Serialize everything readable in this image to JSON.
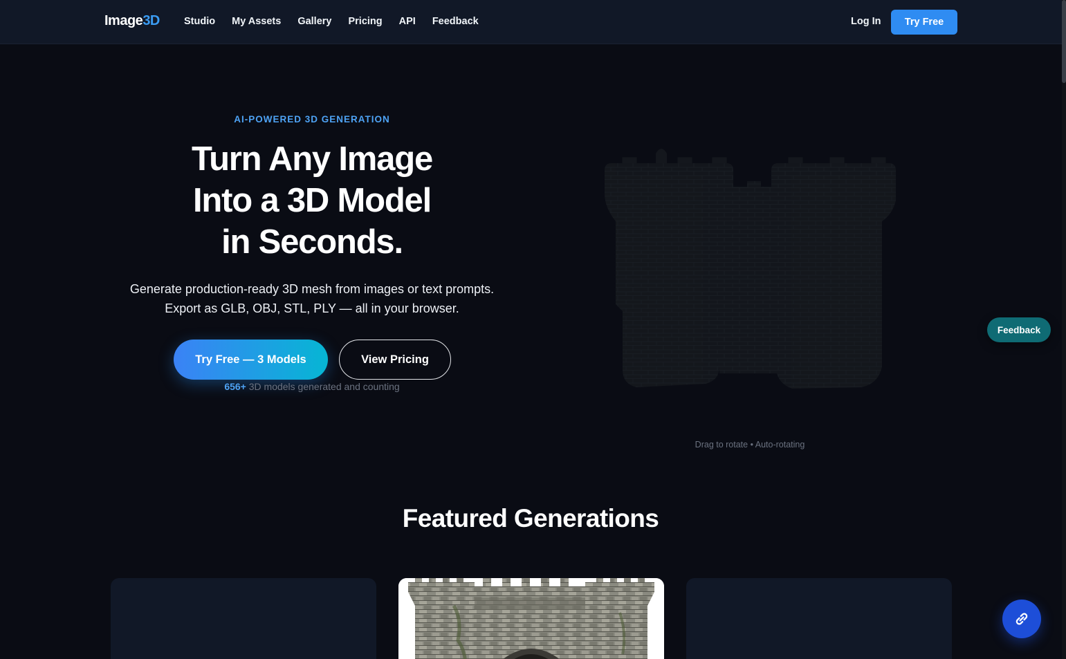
{
  "brand": {
    "name_main": "Image",
    "name_accent": "3D"
  },
  "nav": {
    "links": [
      "Studio",
      "My Assets",
      "Gallery",
      "Pricing",
      "API",
      "Feedback"
    ],
    "login": "Log In",
    "try_free": "Try Free"
  },
  "hero": {
    "eyebrow": "AI-POWERED 3D GENERATION",
    "title_line1": "Turn Any Image",
    "title_line2": "Into a 3D Model",
    "title_line3": "in Seconds.",
    "sub_line1": "Generate production-ready 3D mesh from images or text prompts.",
    "sub_line2": "Export as GLB, OBJ, STL, PLY — all in your browser.",
    "cta_primary": "Try Free — 3 Models",
    "cta_secondary": "View Pricing",
    "stat_number": "656+",
    "stat_text": " 3D models generated and counting",
    "viewer_hint": "Drag to rotate • Auto-rotating"
  },
  "floating": {
    "feedback": "Feedback"
  },
  "featured": {
    "title": "Featured Generations"
  },
  "icons": {
    "chat": "link-chat-icon",
    "model": "castle-model"
  },
  "colors": {
    "accent": "#3b9cf3",
    "bg": "#0a0c14",
    "nav_bg": "#111827",
    "feedback_teal": "#0f6b74"
  }
}
